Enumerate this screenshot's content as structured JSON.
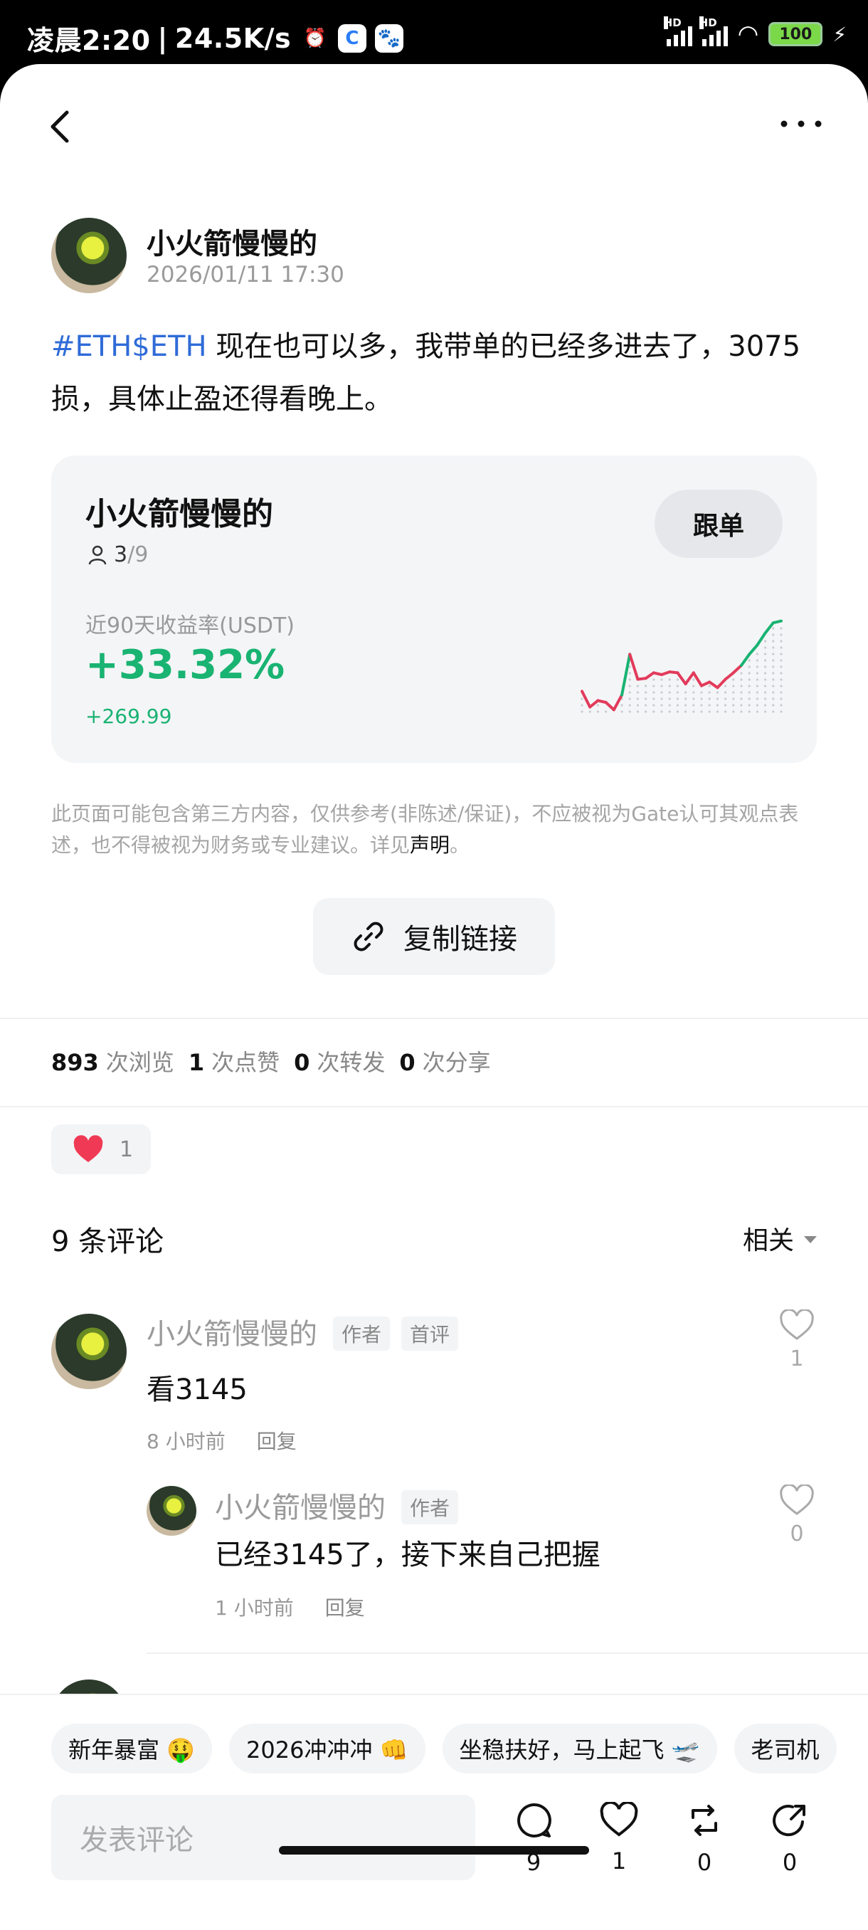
{
  "status_bar": {
    "time": "凌晨2:20",
    "speed": "24.5K/s",
    "battery": "100",
    "network_label": "HD"
  },
  "post": {
    "author": "小火箭慢慢的",
    "time": "2026/01/11 17:30",
    "tag": "#ETH$ETH",
    "text": " 现在也可以多，我带单的已经多进去了，3075损，具体止盈还得看晚上。"
  },
  "trader_card": {
    "name": "小火箭慢慢的",
    "followers_current": "3",
    "followers_max": "9",
    "follow_label": "跟单",
    "roi_label": "近90天收益率(USDT)",
    "roi_pct": "+33.32%",
    "roi_abs": "+269.99",
    "colors": {
      "up": "#19b372",
      "down": "#e23b5b"
    },
    "sparkline": [
      0.22,
      0.05,
      0.12,
      0.1,
      0.02,
      0.18,
      0.62,
      0.35,
      0.36,
      0.42,
      0.4,
      0.43,
      0.42,
      0.3,
      0.42,
      0.28,
      0.32,
      0.26,
      0.35,
      0.42,
      0.5,
      0.62,
      0.72,
      0.85,
      0.96,
      0.98
    ]
  },
  "disclaimer": {
    "text": "此页面可能包含第三方内容，仅供参考(非陈述/保证)，不应被视为Gate认可其观点表述，也不得被视为财务或专业建议。详见",
    "link": "声明",
    "end": "。"
  },
  "copy_link": {
    "label": "复制链接"
  },
  "stats": {
    "views": "893",
    "views_label": "次浏览",
    "likes": "1",
    "likes_label": "次点赞",
    "reposts": "0",
    "reposts_label": "次转发",
    "shares": "0",
    "shares_label": "次分享"
  },
  "reaction": {
    "count": "1"
  },
  "comments_section": {
    "title": "9 条评论",
    "sort_label": "相关"
  },
  "comments": [
    {
      "author": "小火箭慢慢的",
      "badge_author": "作者",
      "badge_first": "首评",
      "text": "看3145",
      "time": "8 小时前",
      "reply": "回复",
      "likes": "1"
    },
    {
      "author": "小火箭慢慢的",
      "badge_author": "作者",
      "text": "已经3145了，接下来自己把握",
      "time": "1 小时前",
      "reply": "回复",
      "likes": "0"
    }
  ],
  "bottom": {
    "chips": [
      "新年暴富 🤑",
      "2026冲冲冲 👊",
      "坐稳扶好，马上起飞 🛫",
      "老司机"
    ],
    "input_placeholder": "发表评论",
    "comment_count": "9",
    "like_count": "1",
    "repost_count": "0",
    "share_count": "0"
  }
}
